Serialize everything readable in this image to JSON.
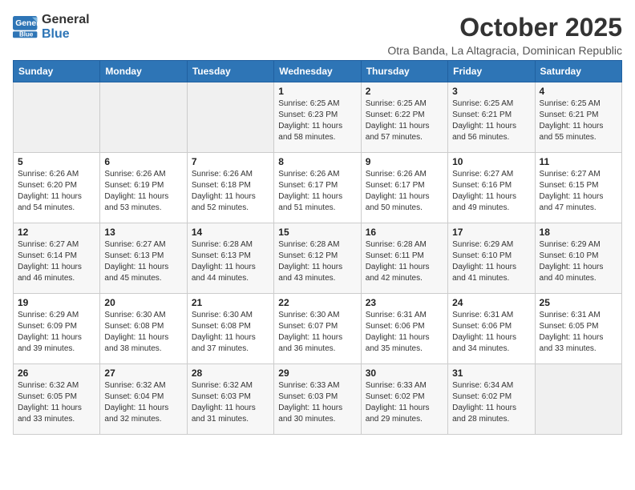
{
  "logo": {
    "line1": "General",
    "line2": "Blue"
  },
  "title": "October 2025",
  "subtitle": "Otra Banda, La Altagracia, Dominican Republic",
  "days_of_week": [
    "Sunday",
    "Monday",
    "Tuesday",
    "Wednesday",
    "Thursday",
    "Friday",
    "Saturday"
  ],
  "weeks": [
    [
      {
        "day": "",
        "info": ""
      },
      {
        "day": "",
        "info": ""
      },
      {
        "day": "",
        "info": ""
      },
      {
        "day": "1",
        "info": "Sunrise: 6:25 AM\nSunset: 6:23 PM\nDaylight: 11 hours\nand 58 minutes."
      },
      {
        "day": "2",
        "info": "Sunrise: 6:25 AM\nSunset: 6:22 PM\nDaylight: 11 hours\nand 57 minutes."
      },
      {
        "day": "3",
        "info": "Sunrise: 6:25 AM\nSunset: 6:21 PM\nDaylight: 11 hours\nand 56 minutes."
      },
      {
        "day": "4",
        "info": "Sunrise: 6:25 AM\nSunset: 6:21 PM\nDaylight: 11 hours\nand 55 minutes."
      }
    ],
    [
      {
        "day": "5",
        "info": "Sunrise: 6:26 AM\nSunset: 6:20 PM\nDaylight: 11 hours\nand 54 minutes."
      },
      {
        "day": "6",
        "info": "Sunrise: 6:26 AM\nSunset: 6:19 PM\nDaylight: 11 hours\nand 53 minutes."
      },
      {
        "day": "7",
        "info": "Sunrise: 6:26 AM\nSunset: 6:18 PM\nDaylight: 11 hours\nand 52 minutes."
      },
      {
        "day": "8",
        "info": "Sunrise: 6:26 AM\nSunset: 6:17 PM\nDaylight: 11 hours\nand 51 minutes."
      },
      {
        "day": "9",
        "info": "Sunrise: 6:26 AM\nSunset: 6:17 PM\nDaylight: 11 hours\nand 50 minutes."
      },
      {
        "day": "10",
        "info": "Sunrise: 6:27 AM\nSunset: 6:16 PM\nDaylight: 11 hours\nand 49 minutes."
      },
      {
        "day": "11",
        "info": "Sunrise: 6:27 AM\nSunset: 6:15 PM\nDaylight: 11 hours\nand 47 minutes."
      }
    ],
    [
      {
        "day": "12",
        "info": "Sunrise: 6:27 AM\nSunset: 6:14 PM\nDaylight: 11 hours\nand 46 minutes."
      },
      {
        "day": "13",
        "info": "Sunrise: 6:27 AM\nSunset: 6:13 PM\nDaylight: 11 hours\nand 45 minutes."
      },
      {
        "day": "14",
        "info": "Sunrise: 6:28 AM\nSunset: 6:13 PM\nDaylight: 11 hours\nand 44 minutes."
      },
      {
        "day": "15",
        "info": "Sunrise: 6:28 AM\nSunset: 6:12 PM\nDaylight: 11 hours\nand 43 minutes."
      },
      {
        "day": "16",
        "info": "Sunrise: 6:28 AM\nSunset: 6:11 PM\nDaylight: 11 hours\nand 42 minutes."
      },
      {
        "day": "17",
        "info": "Sunrise: 6:29 AM\nSunset: 6:10 PM\nDaylight: 11 hours\nand 41 minutes."
      },
      {
        "day": "18",
        "info": "Sunrise: 6:29 AM\nSunset: 6:10 PM\nDaylight: 11 hours\nand 40 minutes."
      }
    ],
    [
      {
        "day": "19",
        "info": "Sunrise: 6:29 AM\nSunset: 6:09 PM\nDaylight: 11 hours\nand 39 minutes."
      },
      {
        "day": "20",
        "info": "Sunrise: 6:30 AM\nSunset: 6:08 PM\nDaylight: 11 hours\nand 38 minutes."
      },
      {
        "day": "21",
        "info": "Sunrise: 6:30 AM\nSunset: 6:08 PM\nDaylight: 11 hours\nand 37 minutes."
      },
      {
        "day": "22",
        "info": "Sunrise: 6:30 AM\nSunset: 6:07 PM\nDaylight: 11 hours\nand 36 minutes."
      },
      {
        "day": "23",
        "info": "Sunrise: 6:31 AM\nSunset: 6:06 PM\nDaylight: 11 hours\nand 35 minutes."
      },
      {
        "day": "24",
        "info": "Sunrise: 6:31 AM\nSunset: 6:06 PM\nDaylight: 11 hours\nand 34 minutes."
      },
      {
        "day": "25",
        "info": "Sunrise: 6:31 AM\nSunset: 6:05 PM\nDaylight: 11 hours\nand 33 minutes."
      }
    ],
    [
      {
        "day": "26",
        "info": "Sunrise: 6:32 AM\nSunset: 6:05 PM\nDaylight: 11 hours\nand 33 minutes."
      },
      {
        "day": "27",
        "info": "Sunrise: 6:32 AM\nSunset: 6:04 PM\nDaylight: 11 hours\nand 32 minutes."
      },
      {
        "day": "28",
        "info": "Sunrise: 6:32 AM\nSunset: 6:03 PM\nDaylight: 11 hours\nand 31 minutes."
      },
      {
        "day": "29",
        "info": "Sunrise: 6:33 AM\nSunset: 6:03 PM\nDaylight: 11 hours\nand 30 minutes."
      },
      {
        "day": "30",
        "info": "Sunrise: 6:33 AM\nSunset: 6:02 PM\nDaylight: 11 hours\nand 29 minutes."
      },
      {
        "day": "31",
        "info": "Sunrise: 6:34 AM\nSunset: 6:02 PM\nDaylight: 11 hours\nand 28 minutes."
      },
      {
        "day": "",
        "info": ""
      }
    ]
  ]
}
